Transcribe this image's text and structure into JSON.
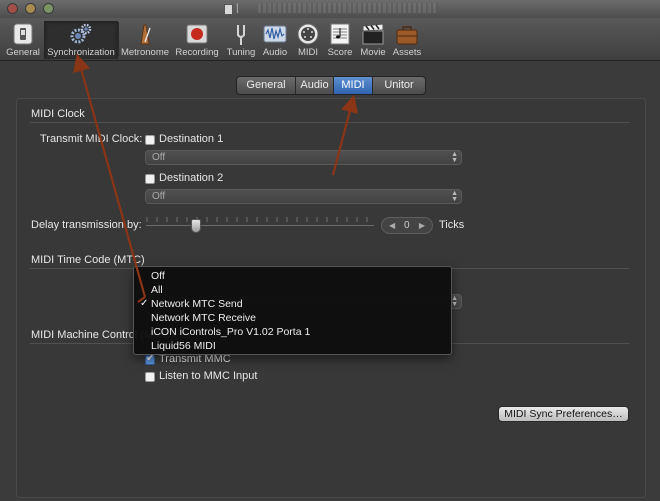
{
  "window": {
    "title_visible": "|"
  },
  "toolbar": {
    "items": [
      {
        "label": "General",
        "icon": "general-switch-icon"
      },
      {
        "label": "Synchronization",
        "icon": "gears-icon"
      },
      {
        "label": "Metronome",
        "icon": "metronome-icon"
      },
      {
        "label": "Recording",
        "icon": "record-icon"
      },
      {
        "label": "Tuning",
        "icon": "tuning-fork-icon"
      },
      {
        "label": "Audio",
        "icon": "audio-waveform-icon"
      },
      {
        "label": "MIDI",
        "icon": "midi-connector-icon"
      },
      {
        "label": "Score",
        "icon": "score-icon"
      },
      {
        "label": "Movie",
        "icon": "clapperboard-icon"
      },
      {
        "label": "Assets",
        "icon": "briefcase-icon"
      }
    ],
    "selected": "Synchronization"
  },
  "tabs": [
    {
      "label": "General"
    },
    {
      "label": "Audio"
    },
    {
      "label": "MIDI"
    },
    {
      "label": "Unitor"
    }
  ],
  "active_tab": "MIDI",
  "midi_clock": {
    "heading": "MIDI Clock",
    "transmit_label": "Transmit MIDI Clock:",
    "dest1_label": "Destination 1",
    "dest1_value": "Off",
    "dest2_label": "Destination 2",
    "dest2_value": "Off",
    "delay_label": "Delay transmission by:",
    "delay_value": "0",
    "delay_unit": "Ticks"
  },
  "mtc": {
    "heading": "MIDI Time Code (MTC)",
    "menu_options": [
      "Off",
      "All",
      "Network MTC Send",
      "Network MTC Receive",
      "iCON iControls_Pro V1.02 Porta 1",
      "Liquid56 MIDI"
    ],
    "selected": "Network MTC Send",
    "selected_index": 2
  },
  "mmc": {
    "heading": "MIDI Machine Control (MMC)",
    "transmit_label": "Transmit MMC",
    "transmit_checked": true,
    "listen_label": "Listen to MMC Input",
    "listen_checked": false
  },
  "sync_prefs_button": "MIDI Sync Preferences…",
  "colors": {
    "accent": "#3a6fc2",
    "annotation_arrow": "#8a3516",
    "background": "#3b3b3b"
  }
}
